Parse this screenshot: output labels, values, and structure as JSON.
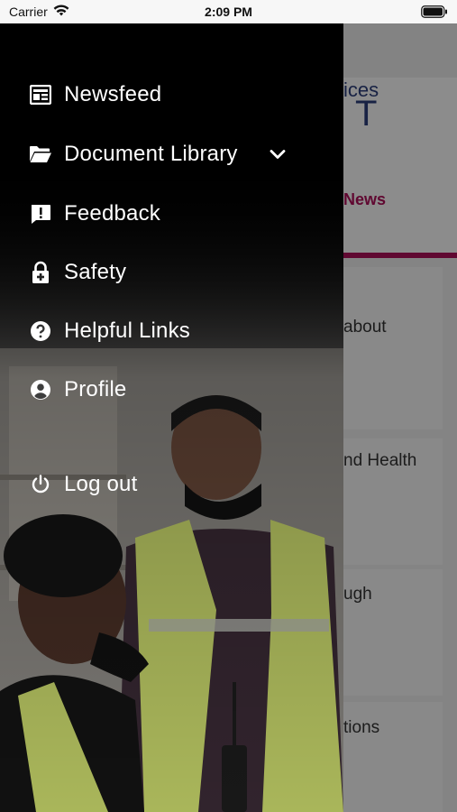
{
  "status_bar": {
    "carrier": "Carrier",
    "time": "2:09 PM"
  },
  "background_app": {
    "brand_sub": "ices",
    "brand_main": "T",
    "tab_label": "News",
    "cards": [
      "about",
      "nd Health",
      "ugh",
      "tions"
    ]
  },
  "drawer": {
    "items": [
      {
        "label": "Newsfeed",
        "icon": "newspaper-icon"
      },
      {
        "label": "Document Library",
        "icon": "folder-open-icon",
        "expandable": true
      },
      {
        "label": "Feedback",
        "icon": "feedback-icon"
      },
      {
        "label": "Safety",
        "icon": "lock-plus-icon"
      },
      {
        "label": "Helpful Links",
        "icon": "help-circle-icon"
      },
      {
        "label": "Profile",
        "icon": "account-circle-icon"
      }
    ],
    "logout_label": "Log out"
  },
  "colors": {
    "accent": "#b0105a",
    "brand": "#2c3f7c"
  }
}
